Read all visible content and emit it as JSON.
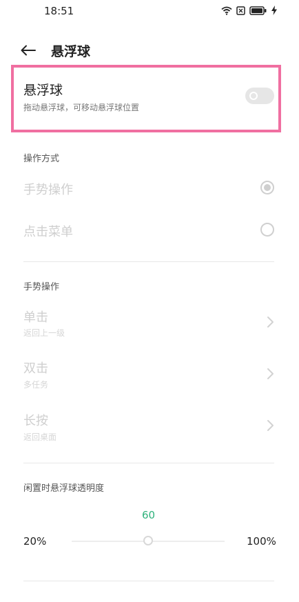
{
  "status_bar": {
    "time": "18:51",
    "icons": [
      "wifi-icon",
      "sim-icon",
      "battery-icon",
      "charging-icon"
    ]
  },
  "header": {
    "back_icon": "arrow-left-icon",
    "title": "悬浮球"
  },
  "floating_ball": {
    "title": "悬浮球",
    "subtitle": "拖动悬浮球，可移动悬浮球位置",
    "enabled": false,
    "highlight_color": "#f06fa1"
  },
  "operation_mode": {
    "section_title": "操作方式",
    "options": [
      {
        "label": "手势操作",
        "selected": true
      },
      {
        "label": "点击菜单",
        "selected": false
      }
    ]
  },
  "gesture_section": {
    "section_title": "手势操作",
    "items": [
      {
        "title": "单击",
        "subtitle": "返回上一级"
      },
      {
        "title": "双击",
        "subtitle": "多任务"
      },
      {
        "title": "长按",
        "subtitle": "返回桌面"
      }
    ]
  },
  "opacity": {
    "section_title": "闲置时悬浮球透明度",
    "value": "60",
    "min_label": "20%",
    "max_label": "100%",
    "min": 20,
    "max": 100,
    "current": 60,
    "accent_color": "#2fb27c"
  }
}
